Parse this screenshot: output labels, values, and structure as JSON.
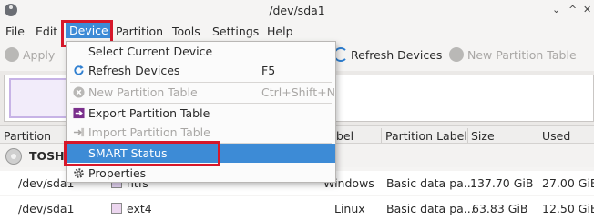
{
  "window": {
    "title": "/dev/sda1",
    "minimize": "⌄",
    "maximize": "^",
    "close": "✕"
  },
  "menubar": {
    "file": "File",
    "edit": "Edit",
    "device": "Device",
    "partition": "Partition",
    "tools": "Tools",
    "settings": "Settings",
    "help": "Help"
  },
  "toolbar": {
    "apply": "Apply",
    "refresh_devices": "Refresh Devices",
    "new_partition_table": "New Partition Table"
  },
  "device_menu": {
    "select_current_device": "Select Current Device",
    "refresh_devices": "Refresh Devices",
    "refresh_devices_accel": "F5",
    "new_partition_table": "New Partition Table",
    "new_partition_table_accel": "Ctrl+Shift+N",
    "export_partition_table": "Export Partition Table",
    "import_partition_table": "Import Partition Table",
    "smart_status": "SMART Status",
    "properties": "Properties"
  },
  "table": {
    "headers": {
      "partition": "Partition",
      "label": "bel",
      "partition_label": "Partition Label",
      "size": "Size",
      "used": "Used"
    },
    "device_row": {
      "name": "TOSHI"
    },
    "rows": [
      {
        "partition": "/dev/sda1",
        "fs": "ntfs",
        "label": "Windows",
        "partition_label": "Basic data pa...",
        "size": "137.70 GiB",
        "used": "27.00 GiE",
        "fs_color": "#e3d3f1"
      },
      {
        "partition": "/dev/sda1",
        "fs": "ext4",
        "label": "Linux",
        "partition_label": "Basic data pa...",
        "size": "63.83 GiB",
        "used": "12.50 GiE",
        "fs_color": "#ecd6ef"
      }
    ]
  },
  "colors": {
    "highlight_box": "#d6172a",
    "selection": "#3d8bd6"
  }
}
